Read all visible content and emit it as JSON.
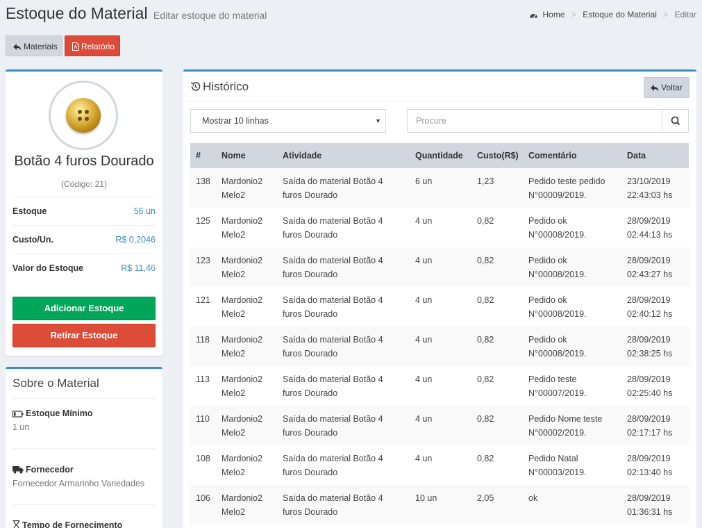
{
  "header": {
    "title": "Estoque do Material",
    "subtitle": "Editar estoque do material",
    "breadcrumb": [
      "Home",
      "Estoque do Material",
      "Editar"
    ]
  },
  "toolbar": {
    "materiais_label": "Materiais",
    "relatorio_label": "Relatório"
  },
  "material": {
    "name": "Botão 4 furos Dourado",
    "code": "(Código: 21)",
    "stats": [
      {
        "label": "Estoque",
        "value": "56 un"
      },
      {
        "label": "Custo/Un.",
        "value": "R$ 0,2046"
      },
      {
        "label": "Valor do Estoque",
        "value": "R$ 11,46"
      }
    ],
    "add_label": "Adicionar Estoque",
    "remove_label": "Retirar Estoque"
  },
  "sobre": {
    "title": "Sobre o Material",
    "items": [
      {
        "icon": "battery-icon",
        "label": "Estoque Mínimo",
        "value": "1 un"
      },
      {
        "icon": "truck-icon",
        "label": "Fornecedor",
        "value": "Fornecedor Armarinho Variedades"
      },
      {
        "icon": "hourglass-icon",
        "label": "Tempo de Fornecimento",
        "value": ""
      }
    ]
  },
  "historico": {
    "title": "Histórico",
    "back_label": "Voltar",
    "length_select": "Mostrar 10 linhas",
    "search_placeholder": "Procure",
    "columns": [
      "#",
      "Nome",
      "Atividade",
      "Quantidade",
      "Custo(R$)",
      "Comentário",
      "Data"
    ],
    "rows": [
      {
        "id": "138",
        "nome": [
          "Mardonio2",
          "Melo2"
        ],
        "atividade": [
          "Saída do material Botão 4",
          "furos Dourado"
        ],
        "quantidade": "6 un",
        "custo": "1,23",
        "comentario": [
          "Pedido teste pedido",
          "N°00009/2019."
        ],
        "data": [
          "23/10/2019",
          "22:43:03 hs"
        ]
      },
      {
        "id": "125",
        "nome": [
          "Mardonio2",
          "Melo2"
        ],
        "atividade": [
          "Saída do material Botão 4",
          "furos Dourado"
        ],
        "quantidade": "4 un",
        "custo": "0,82",
        "comentario": [
          "Pedido ok",
          "N°00008/2019."
        ],
        "data": [
          "28/09/2019",
          "02:44:13 hs"
        ]
      },
      {
        "id": "123",
        "nome": [
          "Mardonio2",
          "Melo2"
        ],
        "atividade": [
          "Saída do material Botão 4",
          "furos Dourado"
        ],
        "quantidade": "4 un",
        "custo": "0,82",
        "comentario": [
          "Pedido ok",
          "N°00008/2019."
        ],
        "data": [
          "28/09/2019",
          "02:43:27 hs"
        ]
      },
      {
        "id": "121",
        "nome": [
          "Mardonio2",
          "Melo2"
        ],
        "atividade": [
          "Saída do material Botão 4",
          "furos Dourado"
        ],
        "quantidade": "4 un",
        "custo": "0,82",
        "comentario": [
          "Pedido ok",
          "N°00008/2019."
        ],
        "data": [
          "28/09/2019",
          "02:40:12 hs"
        ]
      },
      {
        "id": "118",
        "nome": [
          "Mardonio2",
          "Melo2"
        ],
        "atividade": [
          "Saída do material Botão 4",
          "furos Dourado"
        ],
        "quantidade": "4 un",
        "custo": "0,82",
        "comentario": [
          "Pedido ok",
          "N°00008/2019."
        ],
        "data": [
          "28/09/2019",
          "02:38:25 hs"
        ]
      },
      {
        "id": "113",
        "nome": [
          "Mardonio2",
          "Melo2"
        ],
        "atividade": [
          "Saída do material Botão 4",
          "furos Dourado"
        ],
        "quantidade": "4 un",
        "custo": "0,82",
        "comentario": [
          "Pedido teste",
          "N°00007/2019."
        ],
        "data": [
          "28/09/2019",
          "02:25:40 hs"
        ]
      },
      {
        "id": "110",
        "nome": [
          "Mardonio2",
          "Melo2"
        ],
        "atividade": [
          "Saída do material Botão 4",
          "furos Dourado"
        ],
        "quantidade": "4 un",
        "custo": "0,82",
        "comentario": [
          "Pedido Nome teste",
          "N°00002/2019."
        ],
        "data": [
          "28/09/2019",
          "02:17:17 hs"
        ]
      },
      {
        "id": "108",
        "nome": [
          "Mardonio2",
          "Melo2"
        ],
        "atividade": [
          "Saída do material Botão 4",
          "furos Dourado"
        ],
        "quantidade": "4 un",
        "custo": "0,82",
        "comentario": [
          "Pedido Natal",
          "N°00003/2019."
        ],
        "data": [
          "28/09/2019",
          "02:13:40 hs"
        ]
      },
      {
        "id": "106",
        "nome": [
          "Mardonio2",
          "Melo2"
        ],
        "atividade": [
          "Saída do material Botão 4",
          "furos Dourado"
        ],
        "quantidade": "10 un",
        "custo": "2,05",
        "comentario": [
          "ok",
          ""
        ],
        "data": [
          "28/09/2019",
          "01:36:31 hs"
        ]
      }
    ]
  },
  "colors": {
    "primary": "#3c8dbc",
    "success": "#00a65a",
    "danger": "#dd4b39",
    "background": "#ecf0f5",
    "table_header": "#d2d6de"
  }
}
